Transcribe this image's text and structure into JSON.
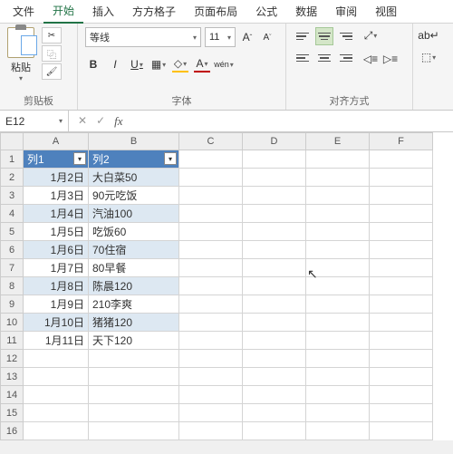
{
  "menu": {
    "file": "文件",
    "home": "开始",
    "insert": "插入",
    "fgz": "方方格子",
    "layout": "页面布局",
    "formula": "公式",
    "data": "数据",
    "review": "审阅",
    "view": "视图"
  },
  "ribbon": {
    "paste_label": "粘贴",
    "clipboard_label": "剪贴板",
    "font_label": "字体",
    "align_label": "对齐方式",
    "font_name": "等线",
    "font_size": "11",
    "bold": "B",
    "italic": "I",
    "underline": "U",
    "wen": "wén"
  },
  "namebox": "E12",
  "formula": "",
  "headers": [
    "列1",
    "列2"
  ],
  "cols": [
    "A",
    "B",
    "C",
    "D",
    "E",
    "F"
  ],
  "rows": [
    {
      "n": "1",
      "a": "列1",
      "b": "列2",
      "hdr": true
    },
    {
      "n": "2",
      "a": "1月2日",
      "b": "大白菜50"
    },
    {
      "n": "3",
      "a": "1月3日",
      "b": "90元吃饭"
    },
    {
      "n": "4",
      "a": "1月4日",
      "b": "汽油100"
    },
    {
      "n": "5",
      "a": "1月5日",
      "b": "吃饭60"
    },
    {
      "n": "6",
      "a": "1月6日",
      "b": "70住宿"
    },
    {
      "n": "7",
      "a": "1月7日",
      "b": "80早餐"
    },
    {
      "n": "8",
      "a": "1月8日",
      "b": "陈晨120"
    },
    {
      "n": "9",
      "a": "1月9日",
      "b": "210李爽"
    },
    {
      "n": "10",
      "a": "1月10日",
      "b": "猪猪120"
    },
    {
      "n": "11",
      "a": "1月11日",
      "b": "天下120"
    },
    {
      "n": "12",
      "a": "",
      "b": ""
    },
    {
      "n": "13",
      "a": "",
      "b": ""
    },
    {
      "n": "14",
      "a": "",
      "b": ""
    },
    {
      "n": "15",
      "a": "",
      "b": ""
    },
    {
      "n": "16",
      "a": "",
      "b": ""
    }
  ]
}
